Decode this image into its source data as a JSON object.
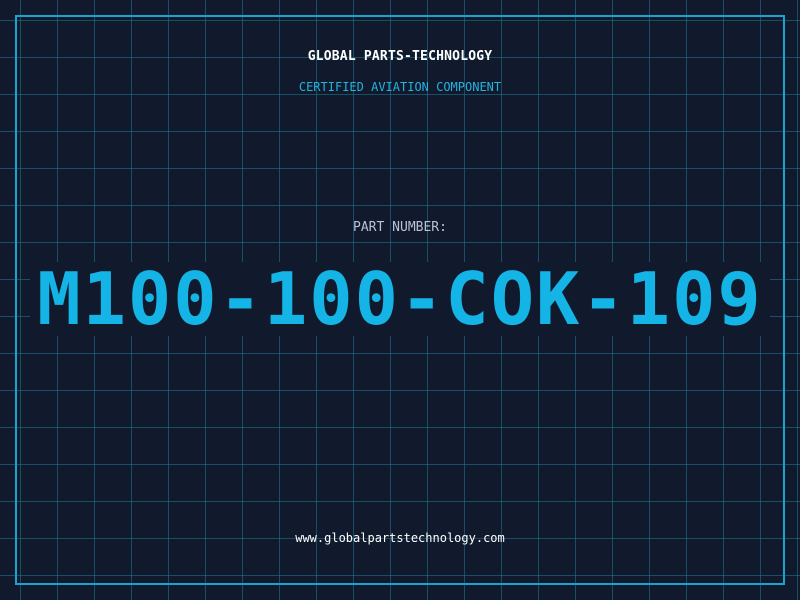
{
  "header": {
    "company": "GLOBAL PARTS-TECHNOLOGY",
    "tagline": "CERTIFIED AVIATION COMPONENT"
  },
  "part": {
    "label": "PART NUMBER:",
    "number": "M100-100-COK-109"
  },
  "footer": {
    "url": "www.globalpartstechnology.com"
  },
  "colors": {
    "background": "#111a2c",
    "grid": "#22789a",
    "frame": "#1aa3cc",
    "accent": "#14b4e6",
    "label": "#b8c3d4",
    "text": "#ffffff"
  }
}
